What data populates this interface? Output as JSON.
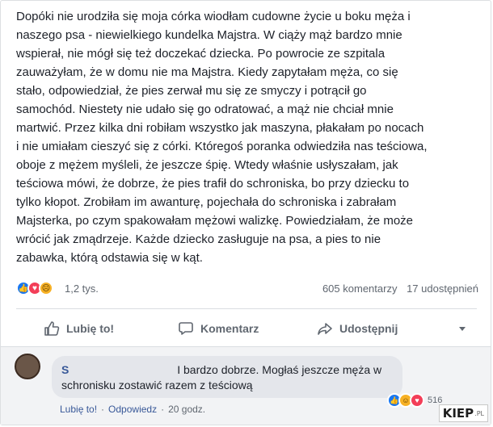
{
  "post": {
    "text": "Dopóki nie urodziła się moja córka wiodłam cudowne życie u boku męża i\nnaszego psa - niewielkiego kundelka Majstra. W ciąży mąż bardzo mnie\nwspierał, nie mógł się też doczekać dziecka. Po powrocie ze szpitala\nzauważyłam, że w domu nie ma Majstra. Kiedy zapytałam męża, co się\nstało, odpowiedział, że pies zerwał mu się ze smyczy i potrącił go\nsamochód. Niestety nie udało się go odratować, a mąż nie chciał mnie\nmartwić. Przez kilka dni robiłam wszystko jak maszyna, płakałam po nocach\ni nie umiałam cieszyć się z córki. Któregoś poranka odwiedziła nas teściowa,\noboje z mężem myśleli, że jeszcze śpię. Wtedy właśnie usłyszałam, jak\nteściowa mówi, że dobrze, że pies trafił do schroniska, bo przy dziecku to\ntylko kłopot. Zrobiłam im awanturę, pojechała do schroniska i zabrałam\nMajsterka, po czym spakowałam mężowi walizkę. Powiedziałam, że może\nwrócić jak zmądrzeje. Każde dziecko zasługuje na psa, a pies to nie\nzabawka, którą odstawia się w kąt."
  },
  "stats": {
    "reactions_count": "1,2 tys.",
    "comments": "605 komentarzy",
    "shares": "17 udostępnień"
  },
  "actions": {
    "like": "Lubię to!",
    "comment": "Komentarz",
    "share": "Udostępnij"
  },
  "comment": {
    "author_initial": "S",
    "text_line1": "I bardzo dobrze. Mogłaś jeszcze męża w",
    "text_line2": "schronisku zostawić razem z teściową",
    "like_link": "Lubię to!",
    "reply_link": "Odpowiedz",
    "time": "20 godz.",
    "reaction_count": "516"
  },
  "watermark": {
    "brand": "KIEP",
    "tld": ".PL"
  }
}
